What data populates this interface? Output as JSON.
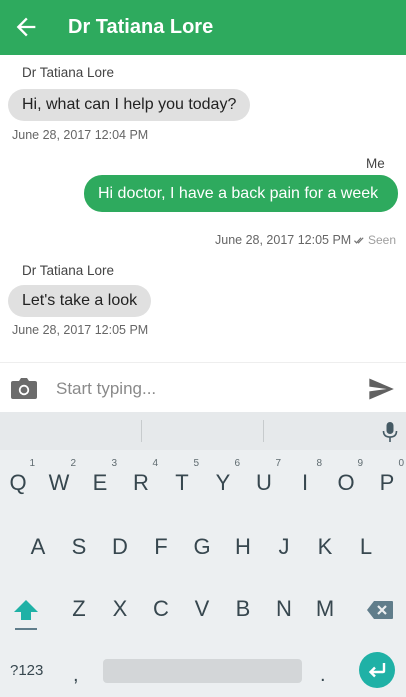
{
  "header": {
    "title": "Dr Tatiana Lore",
    "back_icon": "arrow-back-icon",
    "background": "#2eaa5e"
  },
  "messages": [
    {
      "sender": "Dr Tatiana Lore",
      "text": "Hi, what can I help you today?",
      "time": "June 28, 2017 12:04 PM",
      "direction": "incoming"
    },
    {
      "sender": "Me",
      "text": "Hi doctor, I have a back pain for a week",
      "time": "June 28, 2017 12:05 PM",
      "status": "Seen",
      "direction": "outgoing"
    },
    {
      "sender": "Dr Tatiana Lore",
      "text": "Let's take a look",
      "time": "June 28, 2017 12:05 PM",
      "direction": "incoming"
    }
  ],
  "composer": {
    "placeholder": "Start typing...",
    "camera_icon": "camera-icon",
    "send_icon": "send-icon"
  },
  "keyboard": {
    "row1": [
      "Q",
      "W",
      "E",
      "R",
      "T",
      "Y",
      "U",
      "I",
      "O",
      "P"
    ],
    "row1_hints": [
      "1",
      "2",
      "3",
      "4",
      "5",
      "6",
      "7",
      "8",
      "9",
      "0"
    ],
    "row2": [
      "A",
      "S",
      "D",
      "F",
      "G",
      "H",
      "J",
      "K",
      "L"
    ],
    "row3": [
      "Z",
      "X",
      "C",
      "V",
      "B",
      "N",
      "M"
    ],
    "symbols_label": "?123",
    "comma": ",",
    "period": ".",
    "accent": "#1fb1a6"
  }
}
